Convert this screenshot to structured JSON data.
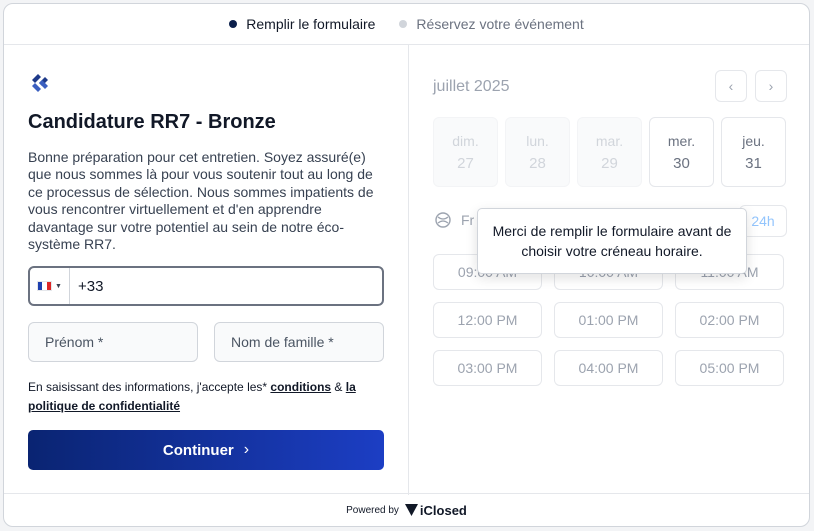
{
  "stepper": {
    "steps": [
      {
        "label": "Remplir le formulaire"
      },
      {
        "label": "Réservez votre événement"
      }
    ]
  },
  "form": {
    "title": "Candidature RR7 - Bronze",
    "description": "Bonne préparation pour cet entretien. Soyez assuré(e) que nous sommes là pour vous soutenir tout au long de ce processus de sélection. Nous sommes impatients de vous rencontrer virtuellement et d'en apprendre davantage sur votre potentiel au sein de notre éco-système RR7.",
    "phone": {
      "country": "FR",
      "value": "+33"
    },
    "first_name_placeholder": "Prénom *",
    "last_name_placeholder": "Nom de famille *",
    "terms": {
      "prefix": "En saisissant des informations, j'accepte les* ",
      "conditions_link": "conditions",
      "joiner": " & ",
      "privacy_link": "la politique de confidentialité"
    },
    "continue_label": "Continuer"
  },
  "calendar": {
    "month": "juillet 2025",
    "days": [
      {
        "name": "dim.",
        "num": "27",
        "enabled": false
      },
      {
        "name": "lun.",
        "num": "28",
        "enabled": false
      },
      {
        "name": "mar.",
        "num": "29",
        "enabled": false
      },
      {
        "name": "mer.",
        "num": "30",
        "enabled": true
      },
      {
        "name": "jeu.",
        "num": "31",
        "enabled": true
      }
    ],
    "timezone_label": "Fr",
    "format_toggle": "24h",
    "slots": [
      "09:00 AM",
      "10:00 AM",
      "11:00 AM",
      "12:00 PM",
      "01:00 PM",
      "02:00 PM",
      "03:00 PM",
      "04:00 PM",
      "05:00 PM"
    ],
    "tooltip": "Merci de remplir le formulaire avant de choisir votre créneau horaire."
  },
  "footer": {
    "powered_by": "Powered by",
    "brand": "iClosed"
  },
  "colors": {
    "primary": "#0a2472",
    "primary_gradient_end": "#1c3ec4",
    "step_active_dot": "#0b1f4b"
  }
}
